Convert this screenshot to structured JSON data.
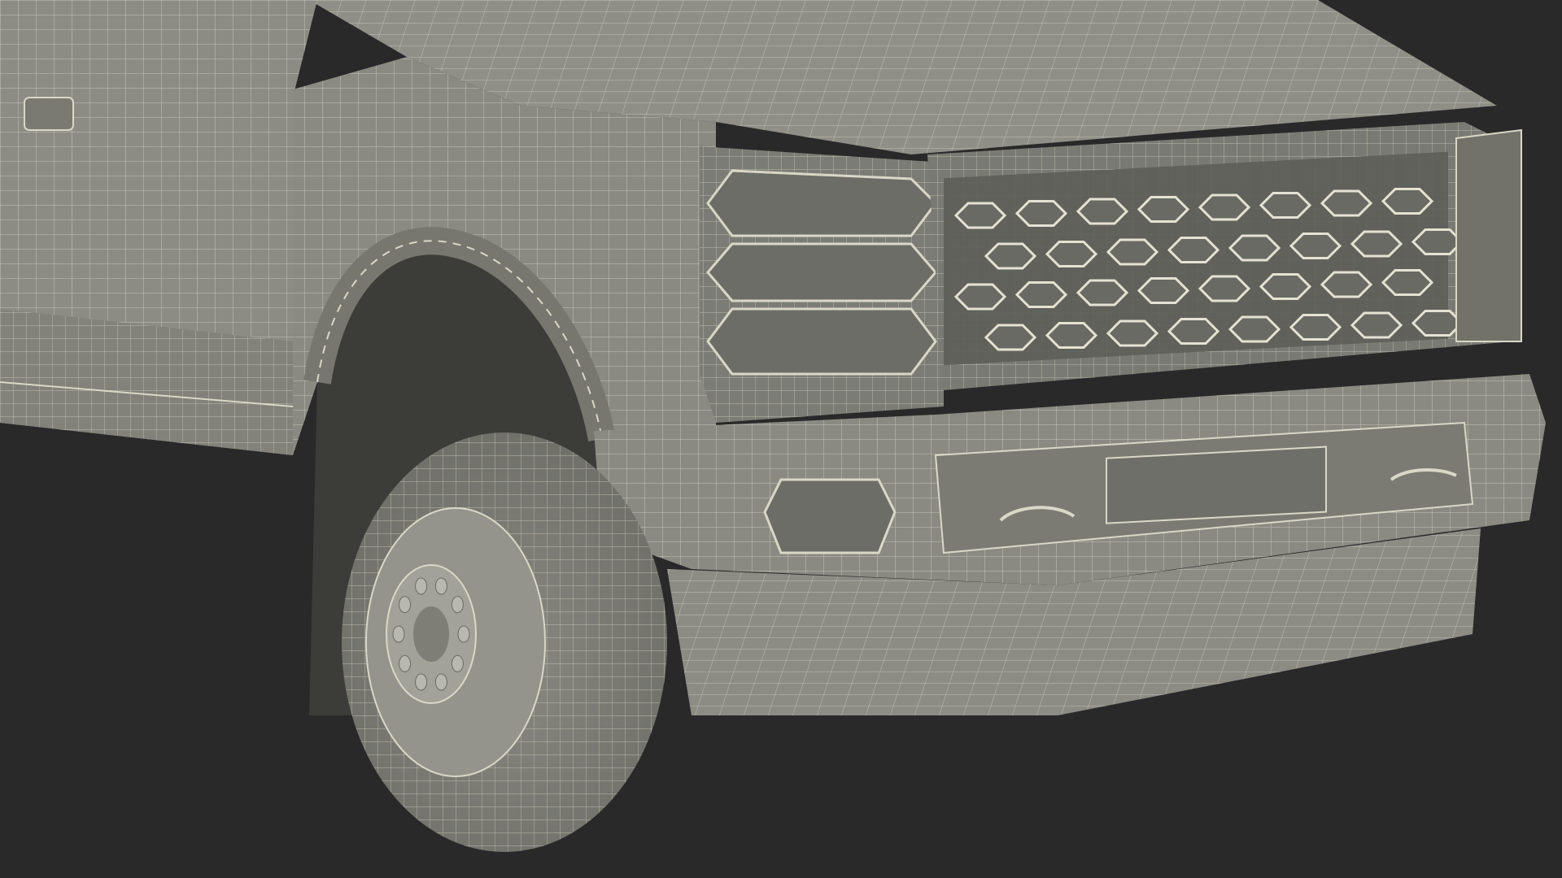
{
  "scene": {
    "subject": "pickup-truck-front-wireframe",
    "colors": {
      "background": "#292929",
      "body": "#8c8c85",
      "body_shadow": "#6f6f69",
      "wire": "#d9d7c7",
      "wheel_well": "#3c3c39",
      "tire": "#7f7f78",
      "rim": "#9a9a92"
    }
  }
}
